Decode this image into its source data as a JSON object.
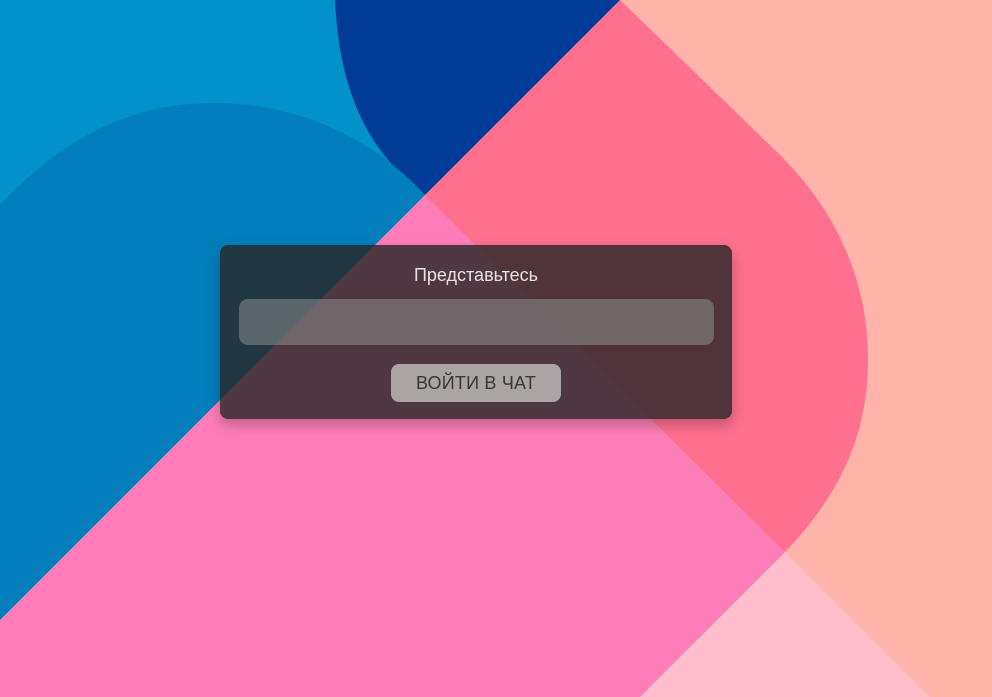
{
  "background": {
    "colors": {
      "blue_light": "#0092c8",
      "blue_mid": "#007fbc",
      "blue_dark": "#003b97",
      "pink_red": "#ff708f",
      "pink": "#ff7eb9",
      "peach": "#ffb3a9",
      "light_pink": "#ffbccb"
    }
  },
  "login": {
    "title": "Представьтесь",
    "input_value": "",
    "input_placeholder": "",
    "button_label": "ВОЙТИ В ЧАТ"
  }
}
